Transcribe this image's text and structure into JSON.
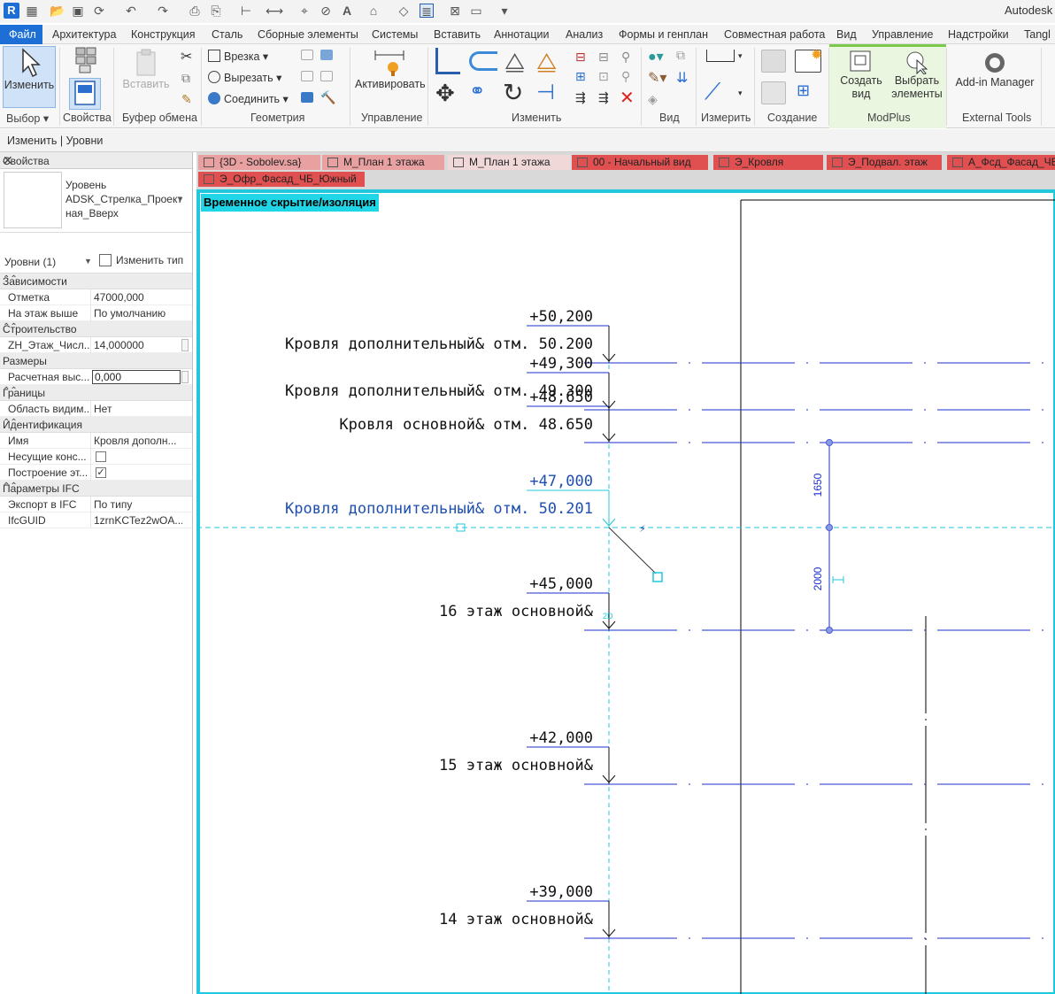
{
  "app": {
    "title": "Autodesk R",
    "logo": "R"
  },
  "ribbon_tabs": [
    "Файл",
    "Архитектура",
    "Конструкция",
    "Сталь",
    "Сборные элементы",
    "Системы",
    "Вставить",
    "Аннотации",
    "Анализ",
    "Формы и генплан",
    "Совместная работа",
    "Вид",
    "Управление",
    "Надстройки",
    "Tangl"
  ],
  "ribbon": {
    "modify_label": "Изменить",
    "paste_label": "Вставить",
    "cut_join_items": [
      "Врезка",
      "Вырезать",
      "Соединить"
    ],
    "activate_label": "Активировать",
    "create_view_label": "Создать вид",
    "select_elements_label": "Выбрать элементы",
    "addin_manager_label": "Add-in Manager",
    "groups": [
      "Выбор",
      "Свойства",
      "Буфер обмена",
      "Геометрия",
      "Управление",
      "Изменить",
      "Вид",
      "Измерить",
      "Создание",
      "ModPlus",
      "External Tools"
    ]
  },
  "context_bar": "Изменить | Уровни",
  "properties": {
    "header": "Свойства",
    "type_category": "Уровень",
    "type_name_line1": "ADSK_Стрелка_Проект",
    "type_name_line2": "ная_Вверх",
    "selection": "Уровни (1)",
    "edit_type": "Изменить тип",
    "groups": [
      {
        "name": "Зависимости",
        "rows": [
          {
            "name": "Отметка",
            "value": "47000,000"
          },
          {
            "name": "На этаж выше",
            "value": "По умолчанию"
          }
        ]
      },
      {
        "name": "Строительство",
        "rows": [
          {
            "name": "ZH_Этаж_Числ...",
            "value": "14,000000"
          }
        ]
      },
      {
        "name": "Размеры",
        "rows": [
          {
            "name": "Расчетная выс...",
            "value": "0,000"
          }
        ]
      },
      {
        "name": "Границы",
        "rows": [
          {
            "name": "Область видим...",
            "value": "Нет"
          }
        ]
      },
      {
        "name": "Идентификация",
        "rows": [
          {
            "name": "Имя",
            "value": "Кровля дополн..."
          },
          {
            "name": "Несущие конс...",
            "value": ""
          },
          {
            "name": "Построение эт...",
            "value": ""
          }
        ]
      },
      {
        "name": "Параметры IFC",
        "rows": [
          {
            "name": "Экспорт в IFC",
            "value": "По типу"
          },
          {
            "name": "IfcGUID",
            "value": "1zrnKCTez2wOA..."
          }
        ]
      }
    ]
  },
  "view_tabs": [
    {
      "label": "{3D - Sobolev.sa}",
      "color": "#e8a0a0"
    },
    {
      "label": "М_План 1 этажа",
      "color": "#e8a0a0"
    },
    {
      "label": "М_План 1 этажа",
      "color": "#f0d8d8"
    },
    {
      "label": "00 - Начальный вид",
      "color": "#e05050"
    },
    {
      "label": "Э_Кровля",
      "color": "#e05050"
    },
    {
      "label": "Э_Подвал. этаж",
      "color": "#e05050"
    },
    {
      "label": "А_Фсд_Фасад_ЧБ_",
      "color": "#e05050"
    },
    {
      "label": "Э_Офр_Фасад_ЧБ_Южный",
      "color": "#e05050"
    }
  ],
  "canvas": {
    "temp_banner": "Временное скрытие/изоляция",
    "levels": [
      {
        "elev": "+50,200",
        "name": "Кровля дополнительный& отм. 50.200",
        "selected": false
      },
      {
        "elev": "+49,300",
        "name": "Кровля дополнительный& отм. 49.300",
        "selected": false
      },
      {
        "elev": "+48,650",
        "name": "Кровля основной& отм. 48.650",
        "selected": false
      },
      {
        "elev": "+47,000",
        "name": "Кровля дополнительный& отм. 50.201",
        "selected": true
      },
      {
        "elev": "+45,000",
        "name": "16 этаж основной&",
        "selected": false
      },
      {
        "elev": "+42,000",
        "name": "15 этаж основной&",
        "selected": false
      },
      {
        "elev": "+39,000",
        "name": "14 этаж основной&",
        "selected": false
      }
    ],
    "dimensions": [
      "1650",
      "2000"
    ],
    "badge_2d": "2D",
    "colors": {
      "level_line": "#1a2fcc",
      "selected": "#1f4fae",
      "cyan": "#20c8dc"
    }
  }
}
